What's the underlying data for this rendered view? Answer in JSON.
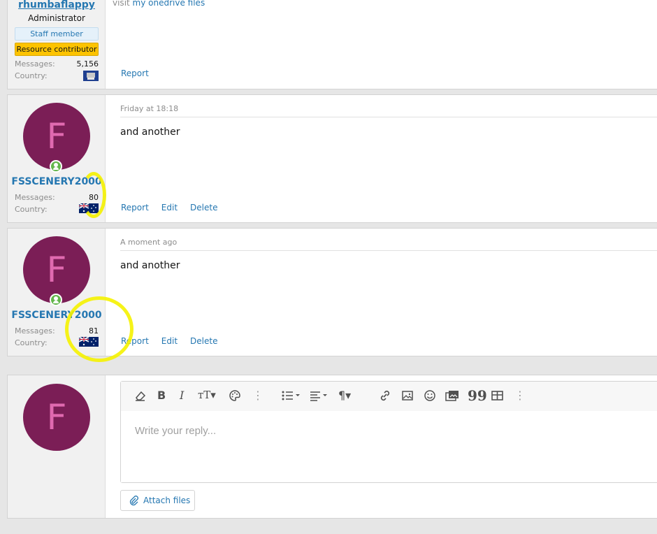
{
  "posts": [
    {
      "username": "rhumbaflappy",
      "user_title": "Administrator",
      "banners": [
        "Staff member",
        "Resource contributor"
      ],
      "stats": {
        "messages_label": "Messages:",
        "messages": "5,156",
        "country_label": "Country:"
      },
      "body_prefix": "visit ",
      "body_link": "my onedrive files",
      "actions": [
        "Report"
      ]
    },
    {
      "avatar_letter": "F",
      "username": "FSSCENERY2000",
      "date": "Friday at 18:18",
      "stats": {
        "messages_label": "Messages:",
        "messages": "80",
        "country_label": "Country:"
      },
      "body": "and another",
      "actions": [
        "Report",
        "Edit",
        "Delete"
      ]
    },
    {
      "avatar_letter": "F",
      "username": "FSSCENERY2000",
      "date": "A moment ago",
      "stats": {
        "messages_label": "Messages:",
        "messages": "81",
        "country_label": "Country:"
      },
      "body": "and another",
      "actions": [
        "Report",
        "Edit",
        "Delete"
      ]
    }
  ],
  "reply": {
    "avatar_letter": "F",
    "placeholder": "Write your reply...",
    "attach_label": "Attach files",
    "toolbar_icons": [
      "eraser-icon",
      "bold-icon",
      "italic-icon",
      "text-size-icon",
      "palette-icon",
      "more-vertical-icon",
      "list-icon",
      "align-icon",
      "paragraph-icon",
      "link-icon",
      "image-icon",
      "smiley-icon",
      "media-icon",
      "quote-icon",
      "table-icon",
      "more-vertical-icon"
    ]
  },
  "colors": {
    "accent": "#2577b1",
    "avatar_bg": "#7b1e56",
    "avatar_fg": "#e06ab0",
    "highlight": "#f5f200"
  }
}
